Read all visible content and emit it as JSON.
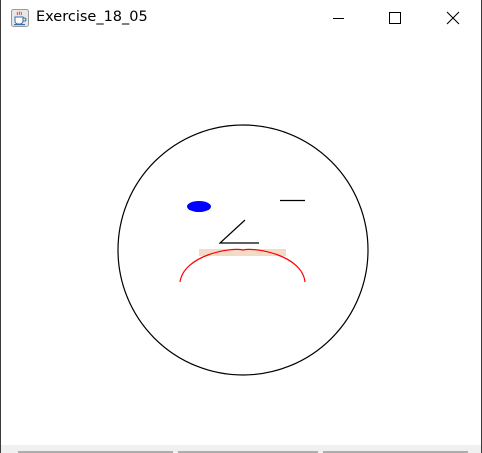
{
  "window": {
    "title": "Exercise_18_05",
    "app_icon": "java-coffee-cup-icon",
    "controls": {
      "minimize_icon": "minimize-icon",
      "maximize_icon": "maximize-icon",
      "close_icon": "close-icon"
    }
  },
  "drawing": {
    "face_stroke": "#000000",
    "left_eye_fill": "#0000ff",
    "right_eye_stroke": "#000000",
    "nose_stroke": "#000000",
    "mouth_stroke": "#ff0000",
    "mouth_highlight": "#f2dcc8"
  },
  "bottom_buttons": [
    "",
    "",
    ""
  ]
}
